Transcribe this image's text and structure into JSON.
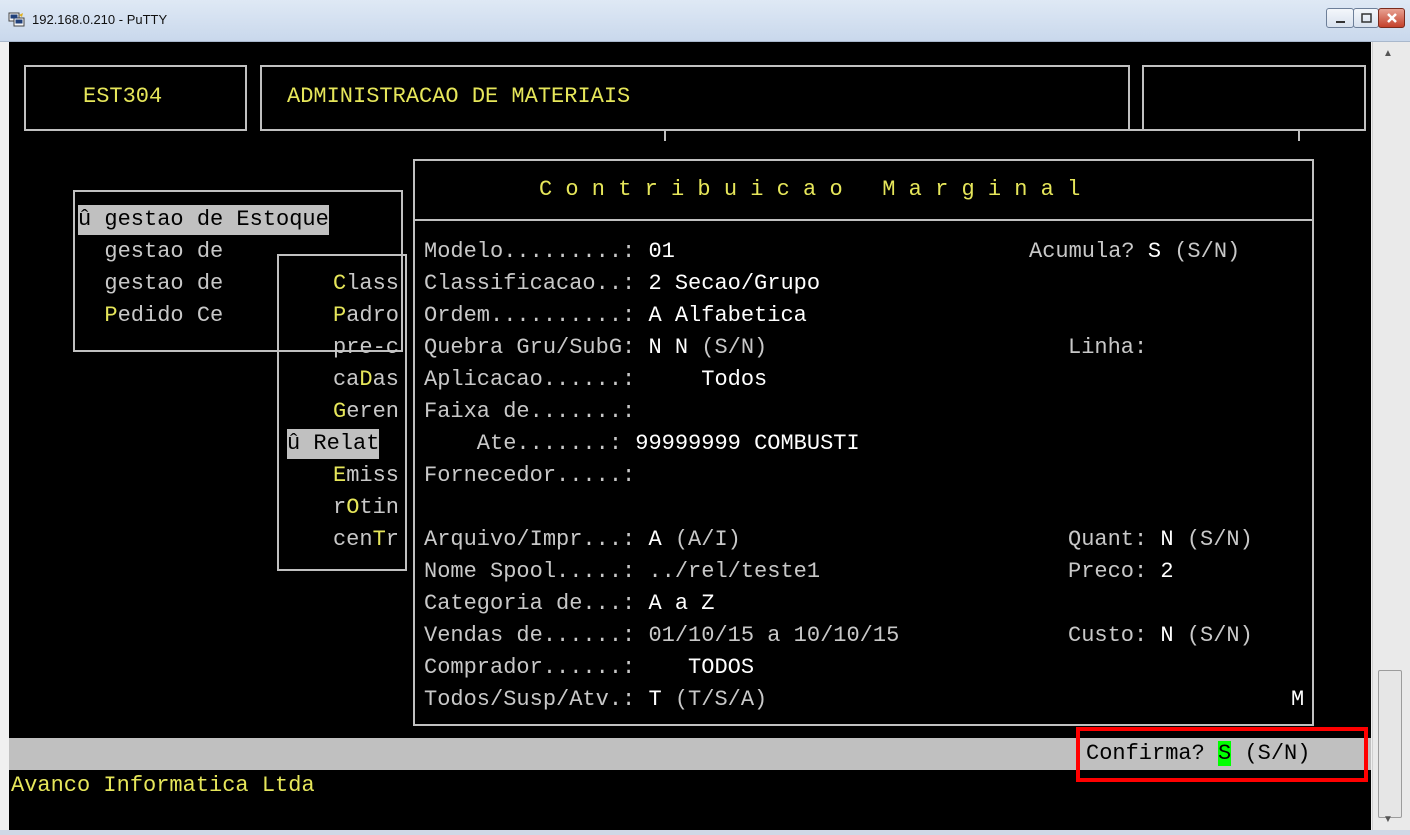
{
  "window": {
    "title": "192.168.0.210 - PuTTY",
    "app_icon": "putty-icon",
    "controls": [
      "minimize-icon",
      "maximize-icon",
      "close-icon"
    ]
  },
  "header": {
    "program_code": "EST304",
    "module_title": "ADMINISTRACAO DE MATERIAIS"
  },
  "menu1": {
    "selected": "û gestao de Estoque",
    "items": [
      {
        "prefix": "  gestao de",
        "hot": "",
        "rest": ""
      },
      {
        "prefix": "  gestao de",
        "hot": "",
        "rest": ""
      },
      {
        "prefix": "  ",
        "hot": "P",
        "rest": "edido Ce"
      }
    ]
  },
  "menu2": {
    "items": [
      {
        "pre": "",
        "hot": "C",
        "rest": "lass"
      },
      {
        "pre": "",
        "hot": "P",
        "rest": "adro"
      },
      {
        "pre": "pre-c",
        "hot": "",
        "rest": ""
      },
      {
        "pre": "ca",
        "hot": "D",
        "rest": "as"
      },
      {
        "pre": "",
        "hot": "G",
        "rest": "eren"
      },
      {
        "pre": "",
        "hot": "",
        "rest": ""
      },
      {
        "pre": "",
        "hot": "E",
        "rest": "miss"
      },
      {
        "pre": "r",
        "hot": "O",
        "rest": "tin"
      },
      {
        "pre": "cen",
        "hot": "T",
        "rest": "r"
      }
    ],
    "selected": "û Relat"
  },
  "dialog": {
    "title": "C o n t r i b u i c a o   M a r g i n a l",
    "fields": [
      {
        "label": "Modelo.........:",
        "value": "01"
      },
      {
        "label": "Classificacao..:",
        "value": "2 Secao/Grupo"
      },
      {
        "label": "Ordem..........:",
        "value": "A Alfabetica"
      },
      {
        "label": "Quebra Gru/SubG:",
        "value": "N N",
        "hint": "(S/N)"
      },
      {
        "label": "Aplicacao......:",
        "value": "    Todos"
      },
      {
        "label": "Faixa de.......:",
        "value": ""
      },
      {
        "label": "    Ate.......:",
        "value": "99999999 COMBUSTI"
      },
      {
        "label": "Fornecedor.....:",
        "value": ""
      },
      {
        "label": "",
        "value": ""
      },
      {
        "label": "Arquivo/Impr...:",
        "value": "A",
        "hint": "(A/I)"
      },
      {
        "label": "Nome Spool.....:",
        "value": "../rel/teste1"
      },
      {
        "label": "Categoria de...:",
        "value": "A a Z"
      },
      {
        "label": "Vendas de......:",
        "value": "01/10/15 a 10/10/15"
      },
      {
        "label": "Comprador......:",
        "value": "   TODOS"
      },
      {
        "label": "Todos/Susp/Atv.:",
        "value": "T",
        "hint": "(T/S/A)"
      }
    ],
    "right_fields": [
      {
        "label": "Acumula?",
        "value": "S",
        "hint": "(S/N)"
      },
      {
        "label": "Linha:",
        "value": ""
      },
      {
        "label": "Quant:",
        "value": "N",
        "hint": "(S/N)"
      },
      {
        "label": "Preco:",
        "value": "2",
        "hint": ""
      },
      {
        "label": "Custo:",
        "value": "N",
        "hint": "(S/N)"
      }
    ],
    "corner_mark": "M"
  },
  "status": {
    "confirm_label": "Confirma?",
    "confirm_value": "S",
    "confirm_hint": "(S/N)",
    "company": "Avanco Informatica Ltda"
  },
  "colors": {
    "terminal_bg": "#000000",
    "yellow_text": "#e6e65a",
    "highlight_bg": "#c0c0c0",
    "cursor_green": "#00ff00",
    "annotation_red": "#ff0000"
  }
}
